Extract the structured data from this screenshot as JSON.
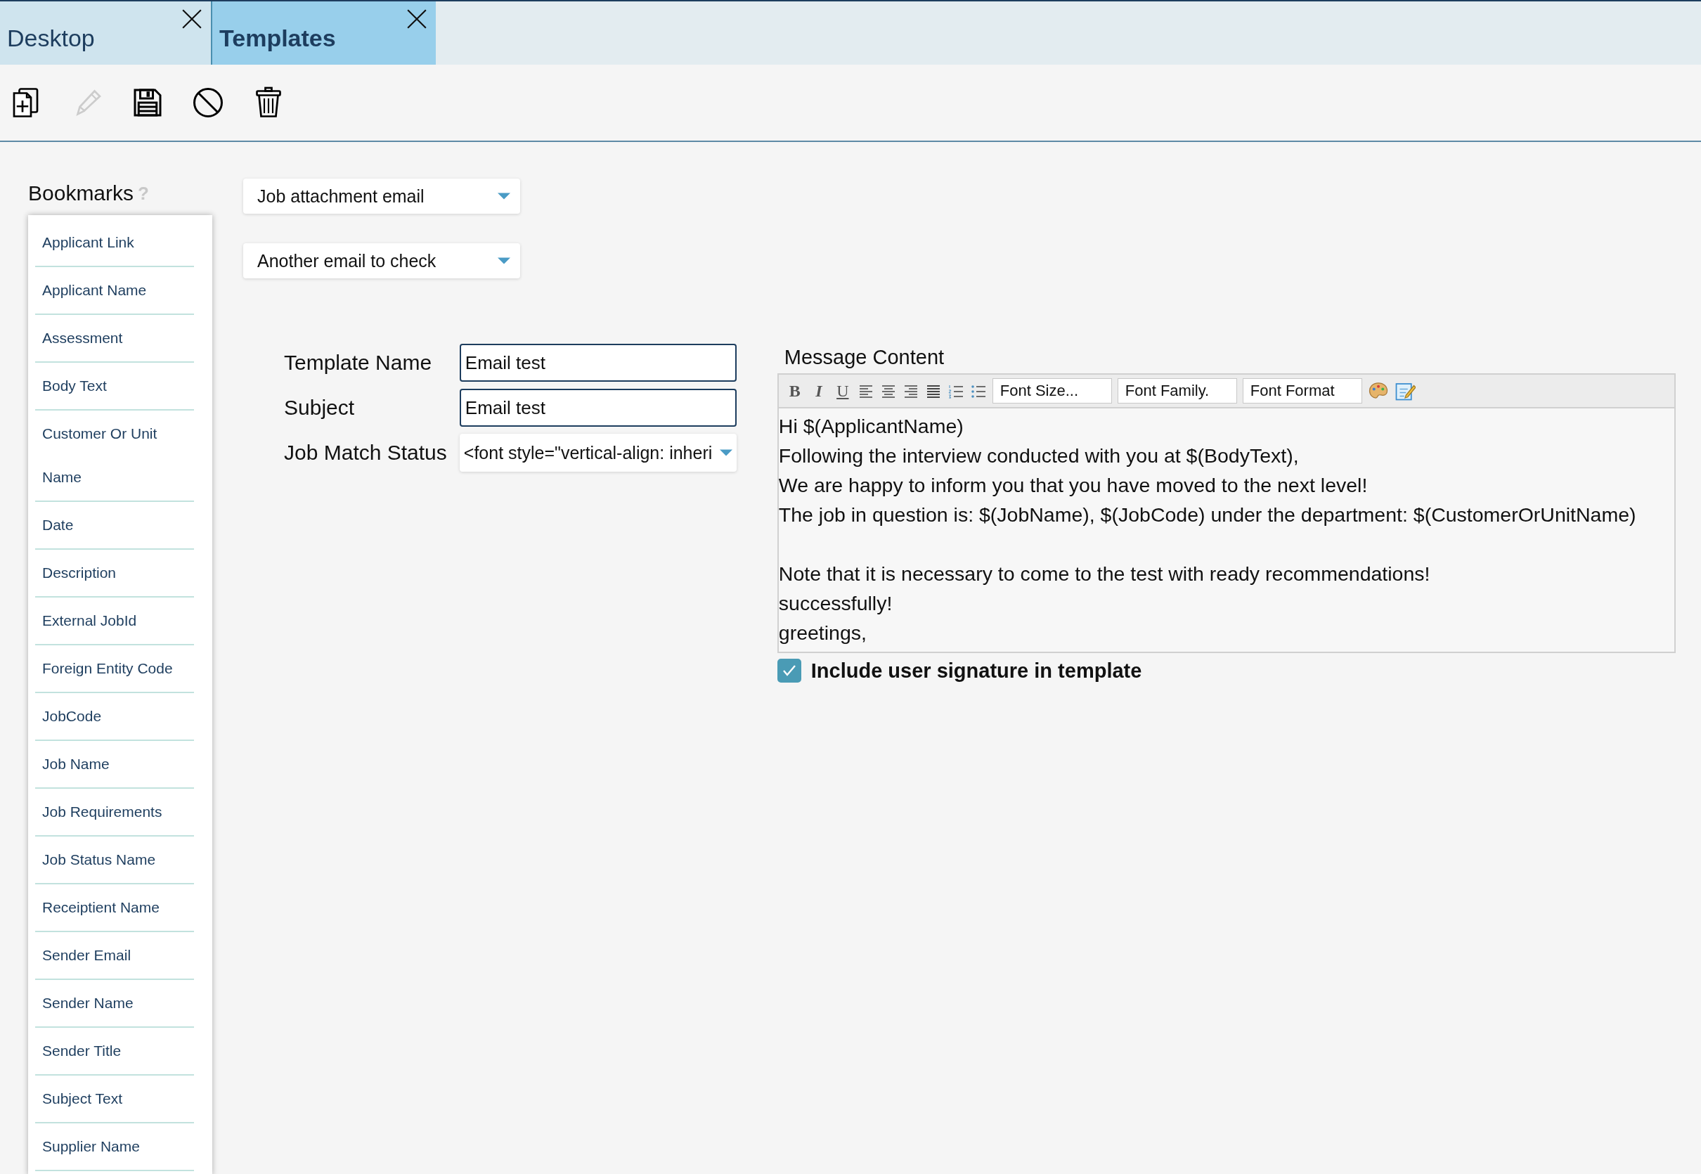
{
  "tabs": [
    {
      "label": "Desktop",
      "selected": false
    },
    {
      "label": "Templates",
      "selected": true
    }
  ],
  "toolbar": [
    {
      "kind": "new",
      "disabled": false
    },
    {
      "kind": "edit",
      "disabled": true
    },
    {
      "kind": "save",
      "disabled": false
    },
    {
      "kind": "cancel",
      "disabled": false
    },
    {
      "kind": "delete",
      "disabled": false
    }
  ],
  "bookmarks": {
    "title": "Bookmarks",
    "help": "?",
    "items": [
      "Applicant Link",
      "Applicant Name",
      "Assessment",
      "Body Text",
      "Customer Or Unit Name",
      "Date",
      "Description",
      "External JobId",
      "Foreign Entity Code",
      "JobCode",
      "Job Name",
      "Job Requirements",
      "Job Status Name",
      "Receiptient Name",
      "Sender Email",
      "Sender Name",
      "Sender Title",
      "Subject Text",
      "Supplier Name"
    ]
  },
  "selectors": [
    "Job attachment email",
    "Another email to check"
  ],
  "form": {
    "fields": [
      {
        "label": "Template Name",
        "value": "Email test",
        "kind": "text"
      },
      {
        "label": "Subject",
        "value": "Email test",
        "kind": "text"
      },
      {
        "label": "Job Match Status",
        "value": "<font style=\"vertical-align: inheri",
        "kind": "select"
      }
    ]
  },
  "message": {
    "label": "Message Content",
    "tools": [
      {
        "kind": "bold",
        "text": "B"
      },
      {
        "kind": "italic",
        "text": "I"
      },
      {
        "kind": "underline",
        "text": "U"
      },
      {
        "kind": "align-left"
      },
      {
        "kind": "align-center"
      },
      {
        "kind": "align-right"
      },
      {
        "kind": "justify"
      },
      {
        "kind": "ordered-list"
      },
      {
        "kind": "bullet-list"
      },
      {
        "kind": "select",
        "text": "Font Size..."
      },
      {
        "kind": "select",
        "text": "Font Family."
      },
      {
        "kind": "select",
        "text": "Font Format"
      },
      {
        "kind": "palette"
      },
      {
        "kind": "edit-source"
      }
    ],
    "paragraphs": [
      [
        "Hi $(ApplicantName)",
        "Following the interview conducted with you at $(BodyText),",
        "We are happy to inform you that you have moved to the next level!",
        "The job in question is: $(JobName), $(JobCode) under the department: $(CustomerOrUnitName)"
      ],
      [
        "Note that it is necessary to come to the test with ready recommendations!",
        "successfully!",
        "greetings,"
      ]
    ]
  },
  "signature": {
    "label": "Include user signature in template",
    "checked": true
  }
}
